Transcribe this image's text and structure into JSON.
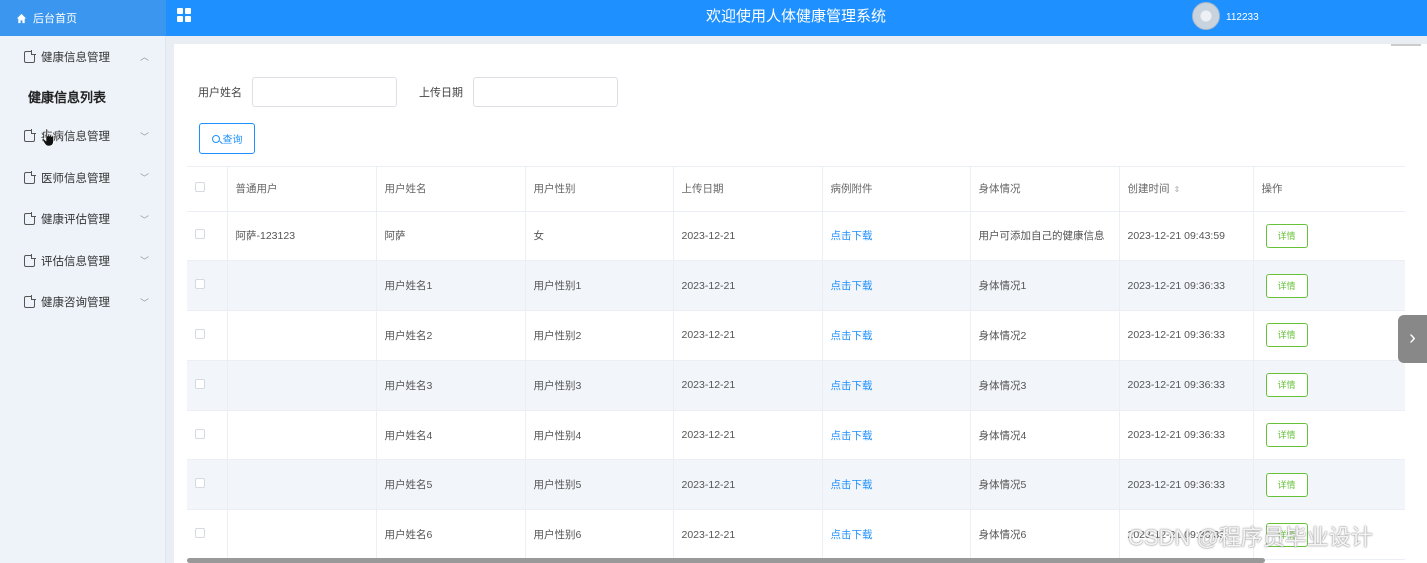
{
  "header": {
    "home_label": "后台首页",
    "title": "欢迎使用人体健康管理系统",
    "username": "112233"
  },
  "sidebar": {
    "items": [
      {
        "label": "健康信息管理",
        "chevron": "up",
        "submenu": [
          "健康信息列表"
        ]
      },
      {
        "label": "疾病信息管理",
        "chevron": "down"
      },
      {
        "label": "医师信息管理",
        "chevron": "down"
      },
      {
        "label": "健康评估管理",
        "chevron": "down"
      },
      {
        "label": "评估信息管理",
        "chevron": "down"
      },
      {
        "label": "健康咨询管理",
        "chevron": "down"
      }
    ]
  },
  "search": {
    "username_label": "用户姓名",
    "username_value": "",
    "date_label": "上传日期",
    "date_value": "",
    "query_button": "查询"
  },
  "table": {
    "columns": [
      "普通用户",
      "用户姓名",
      "用户性别",
      "上传日期",
      "病例附件",
      "身体情况",
      "创建时间",
      "操作"
    ],
    "rows": [
      {
        "user": "阿萨-123123",
        "name": "阿萨",
        "gender": "女",
        "date": "2023-12-21",
        "attachment": "点击下载",
        "condition": "用户可添加自己的健康信息",
        "created": "2023-12-21 09:43:59",
        "action": "详情"
      },
      {
        "user": "",
        "name": "用户姓名1",
        "gender": "用户性别1",
        "date": "2023-12-21",
        "attachment": "点击下载",
        "condition": "身体情况1",
        "created": "2023-12-21 09:36:33",
        "action": "详情"
      },
      {
        "user": "",
        "name": "用户姓名2",
        "gender": "用户性别2",
        "date": "2023-12-21",
        "attachment": "点击下载",
        "condition": "身体情况2",
        "created": "2023-12-21 09:36:33",
        "action": "详情"
      },
      {
        "user": "",
        "name": "用户姓名3",
        "gender": "用户性别3",
        "date": "2023-12-21",
        "attachment": "点击下载",
        "condition": "身体情况3",
        "created": "2023-12-21 09:36:33",
        "action": "详情"
      },
      {
        "user": "",
        "name": "用户姓名4",
        "gender": "用户性别4",
        "date": "2023-12-21",
        "attachment": "点击下载",
        "condition": "身体情况4",
        "created": "2023-12-21 09:36:33",
        "action": "详情"
      },
      {
        "user": "",
        "name": "用户姓名5",
        "gender": "用户性别5",
        "date": "2023-12-21",
        "attachment": "点击下载",
        "condition": "身体情况5",
        "created": "2023-12-21 09:36:33",
        "action": "详情"
      },
      {
        "user": "",
        "name": "用户姓名6",
        "gender": "用户性别6",
        "date": "2023-12-21",
        "attachment": "点击下载",
        "condition": "身体情况6",
        "created": "2023-12-21 09:36:33",
        "action": "详情"
      }
    ]
  },
  "watermark": "CSDN @程序员毕业设计",
  "colors": {
    "header_bg": "#1e90ff",
    "sidebar_bg": "#eef3f9",
    "link": "#1e90ff",
    "detail_button": "#67c23a"
  },
  "icons": [
    "home-icon",
    "grid-menu-icon",
    "avatar",
    "document-icon",
    "chevron-icon",
    "search-icon",
    "sort-icon",
    "chevron-right-icon",
    "hand-cursor-icon"
  ]
}
